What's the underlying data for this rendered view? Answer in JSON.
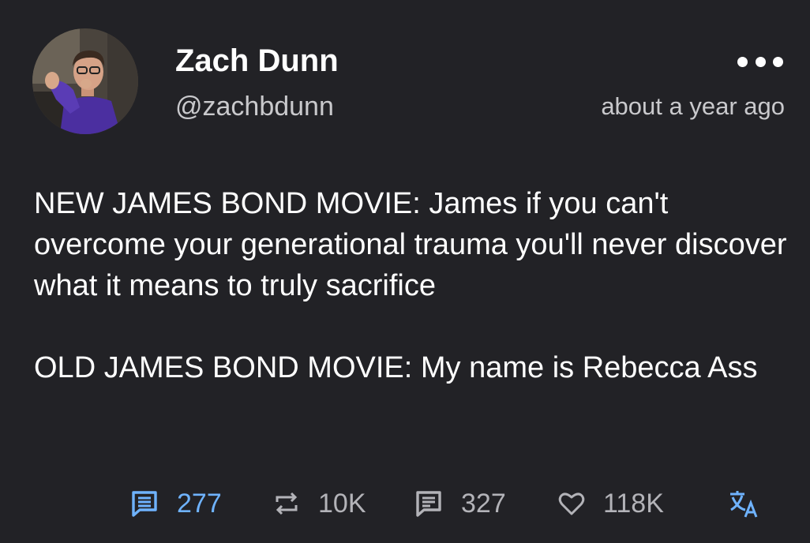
{
  "author": {
    "display_name": "Zach Dunn",
    "handle": "@zachbdunn"
  },
  "timestamp": "about a year ago",
  "icons": {
    "more": "more-dots-icon",
    "comments": "comment-icon",
    "retweets": "retweet-icon",
    "quotes": "quote-icon",
    "likes": "heart-icon",
    "translate": "translate-icon"
  },
  "body": {
    "paragraph1": "NEW JAMES BOND MOVIE: James if you can't overcome your generational trauma you'll never discover what it means to truly sacrifice",
    "paragraph2": "OLD JAMES BOND MOVIE: My name is Rebecca Ass"
  },
  "stats": {
    "comments": "277",
    "retweets": "10K",
    "quotes": "327",
    "likes": "118K"
  },
  "colors": {
    "background": "#222226",
    "accent": "#6fb3ff",
    "muted": "#b3b3b8"
  }
}
